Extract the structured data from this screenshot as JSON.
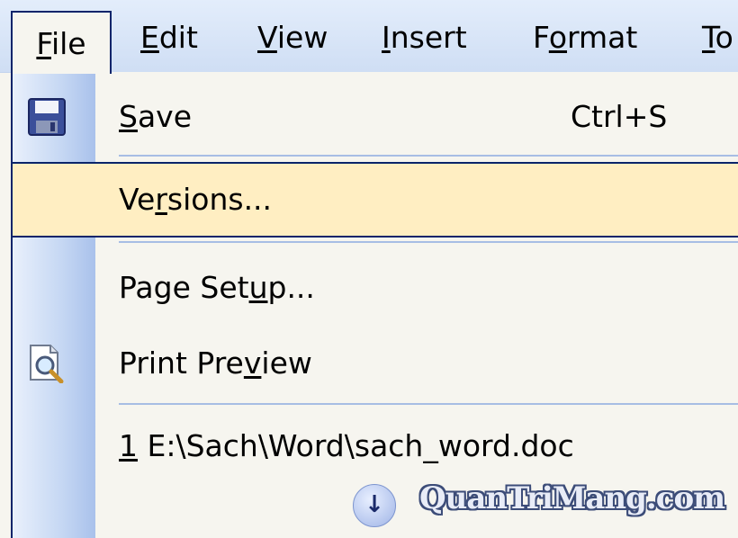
{
  "menubar": {
    "items": [
      {
        "label": "File",
        "underline_index": 0
      },
      {
        "label": "Edit",
        "underline_index": 0
      },
      {
        "label": "View",
        "underline_index": 0
      },
      {
        "label": "Insert",
        "underline_index": 0
      },
      {
        "label": "Format",
        "underline_index": 1
      },
      {
        "label": "To",
        "underline_index": 0
      }
    ]
  },
  "file_menu": {
    "save": {
      "label": "Save",
      "shortcut": "Ctrl+S",
      "icon": "floppy-disk-icon"
    },
    "versions": {
      "label": "Versions...",
      "highlighted": true
    },
    "page_setup": {
      "label": "Page Setup..."
    },
    "print_preview": {
      "label": "Print Preview",
      "icon": "print-preview-icon"
    },
    "recent_file": {
      "number": "1",
      "path": "E:\\Sach\\Word\\sach_word.doc"
    },
    "expand": {
      "icon": "chevron-double-down-icon"
    }
  },
  "watermark": {
    "text": "QuanTriMang.com"
  },
  "colors": {
    "highlight_fill": "#ffeec2",
    "highlight_border": "#0a246a",
    "menubar_bg": "#d9e5f7",
    "separator": "#a7bde4"
  }
}
